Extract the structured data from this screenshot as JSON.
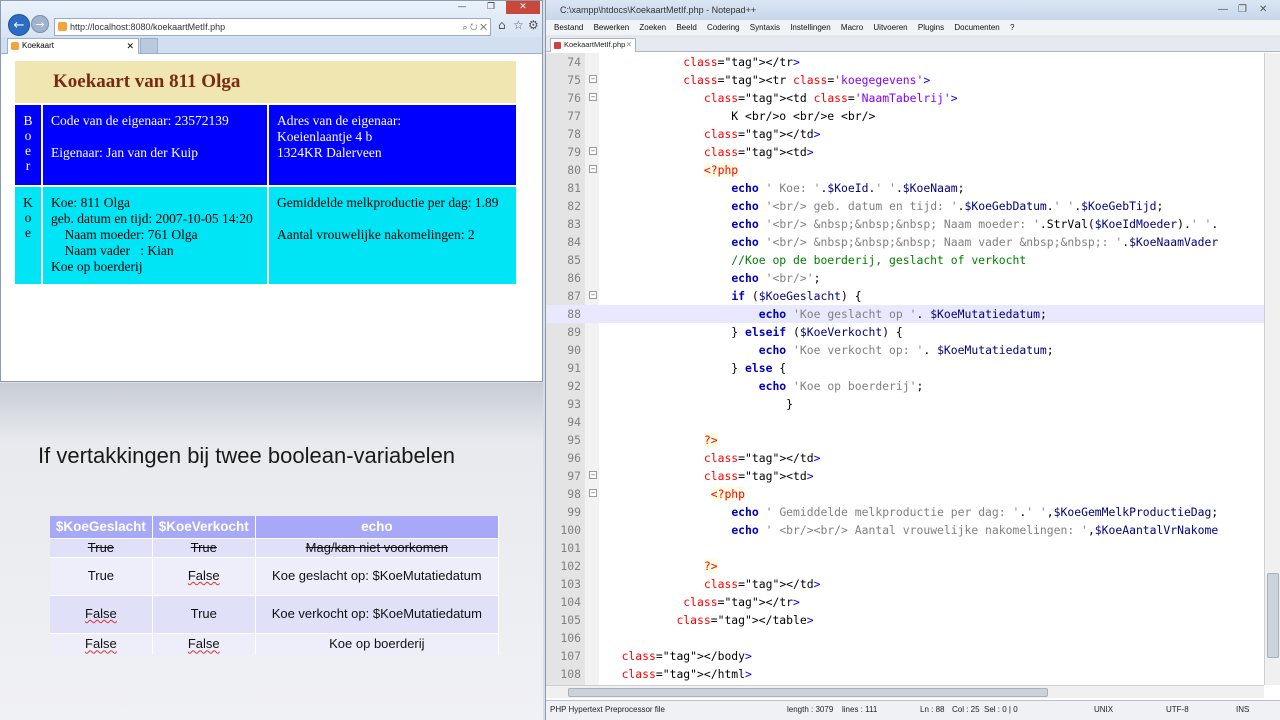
{
  "browser": {
    "address": "http://localhost:8080/koekaartMetIf.php",
    "tab_title": "Koekaart",
    "page": {
      "title": "Koekaart van 811 Olga",
      "boer_vertical": [
        "B",
        "o",
        "e",
        "r"
      ],
      "owner_code": "Code van de eigenaar: 23572139",
      "owner_name": "Eigenaar: Jan van der Kuip",
      "address_label": "Adres van de eigenaar:",
      "address_line1": "Koeienlaantje 4 b",
      "address_line2": "1324KR Dalerveen",
      "koe_vertical": [
        "K",
        "o",
        "e"
      ],
      "koe": "Koe: 811 Olga",
      "geb": "geb. datum en tijd: 2007-10-05 14:20",
      "moeder": "    Naam moeder: 761 Olga",
      "vader": "    Naam vader   : Kian",
      "status": "Koe op boerderij",
      "melk": "Gemiddelde melkproductie per dag: 1.89",
      "nakomelingen": "Aantal vrouwelijke nakomelingen: 2"
    }
  },
  "slide": {
    "title": "If vertakkingen bij twee boolean-variabelen",
    "headers": [
      "$KoeGeslacht",
      "$KoeVerkocht",
      "echo"
    ],
    "rows": [
      {
        "a": "True",
        "b": "True",
        "echo": "Mag/kan niet voorkomen"
      },
      {
        "a": "True",
        "b": "False",
        "echo": "Koe geslacht op: $KoeMutatiedatum"
      },
      {
        "a": "False",
        "b": "True",
        "echo": "Koe verkocht op: $KoeMutatiedatum"
      },
      {
        "a": "False",
        "b": "False",
        "echo": "Koe op boerderij"
      }
    ]
  },
  "npp": {
    "title": "C:\\xampp\\htdocs\\KoekaartMetIf.php - Notepad++",
    "menu": [
      "Bestand",
      "Bewerken",
      "Zoeken",
      "Beeld",
      "Codering",
      "Syntaxis",
      "Instellingen",
      "Macro",
      "Uitvoeren",
      "Plugins",
      "Documenten",
      "?"
    ],
    "tab": "KoekaartMetIf.php",
    "status": {
      "type": "PHP Hypertext Preprocessor file",
      "length": "length : 3079",
      "lines": "lines : 111",
      "pos": "Ln : 88",
      "col": "Col : 25",
      "sel": "Sel : 0 | 0",
      "eol": "UNIX",
      "enc": "UTF-8",
      "ins": "INS"
    },
    "line_numbers": [
      "74",
      "75",
      "76",
      "77",
      "78",
      "79",
      "80",
      "81",
      "82",
      "83",
      "84",
      "85",
      "86",
      "87",
      "88",
      "89",
      "90",
      "91",
      "92",
      "93",
      "94",
      "95",
      "96",
      "97",
      "98",
      "99",
      "100",
      "101",
      "102",
      "103",
      "104",
      "105",
      "106",
      "107",
      "108"
    ],
    "code": [
      "            </tr>",
      "            <tr class='koegegevens'>",
      "               <td class='NaamTabelrij'>",
      "                   K <br/>o <br/>e <br/>",
      "               </td>",
      "               <td>",
      "               <?php",
      "                   echo ' Koe: '.$KoeId.' '.$KoeNaam;",
      "                   echo '<br/> geb. datum en tijd: '.$KoeGebDatum.' '.$KoeGebTijd;",
      "                   echo '<br/> &nbsp;&nbsp;&nbsp; Naam moeder: '.StrVal($KoeIdMoeder).' '.",
      "                   echo '<br/> &nbsp;&nbsp;&nbsp; Naam vader &nbsp;&nbsp;: '.$KoeNaamVader",
      "                   //Koe op de boerderij, geslacht of verkocht",
      "                   echo '<br/>';",
      "                   if ($KoeGeslacht) {",
      "                       echo 'Koe geslacht op '. $KoeMutatiedatum;",
      "                   } elseif ($KoeVerkocht) {",
      "                       echo 'Koe verkocht op: '. $KoeMutatiedatum;",
      "                   } else {",
      "                       echo 'Koe op boerderij';",
      "                           }",
      "",
      "               ?>",
      "               </td>",
      "               <td>",
      "                <?php",
      "                   echo ' Gemiddelde melkproductie per dag: '.' ',$KoeGemMelkProductieDag;",
      "                   echo ' <br/><br/> Aantal vrouwelijke nakomelingen: ',$KoeAantalVrNakome",
      "",
      "               ?>",
      "               </td>",
      "            </tr>",
      "           </table>",
      "",
      "   </body>",
      "   </html>"
    ]
  }
}
